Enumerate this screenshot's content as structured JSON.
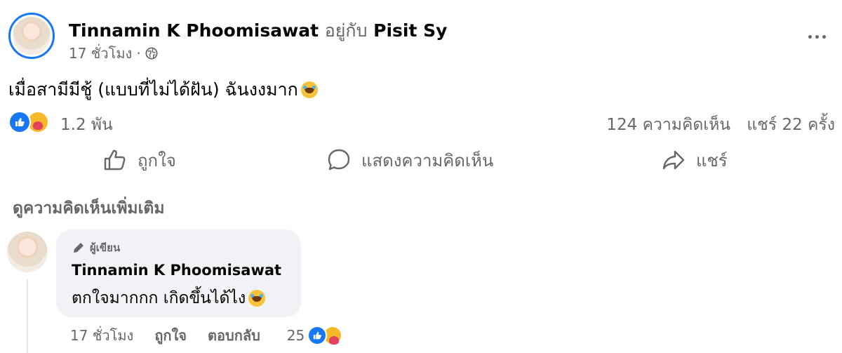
{
  "post": {
    "author": "Tinnamin K Phoomisawat",
    "with_label": "อยู่กับ",
    "tagged": "Pisit Sy",
    "time": "17 ชั่วโมง",
    "separator": "·",
    "privacy_icon": "globe-icon",
    "text": "เมื่อสามีมีชู้ (แบบที่ไม่ได้ฝัน) ฉันงงมาก",
    "emoji_icon": "rofl-emoji-icon"
  },
  "stats": {
    "reaction_count": "1.2 พัน",
    "comments": "124 ความคิดเห็น",
    "shares": "แชร์ 22 ครั้ง"
  },
  "actions": {
    "like": "ถูกใจ",
    "comment": "แสดงความคิดเห็น",
    "share": "แชร์"
  },
  "more_comments": "ดูความคิดเห็นเพิ่มเติม",
  "comment": {
    "badge": "ผู้เขียน",
    "author": "Tinnamin K Phoomisawat",
    "text": "ตกใจมากกก เกิดขึ้นได้ไง",
    "time": "17 ชั่วโมง",
    "like": "ถูกใจ",
    "reply": "ตอบกลับ",
    "reaction_count": "25"
  },
  "colors": {
    "brand": "#1877f2",
    "secondary_text": "#65676b",
    "bubble": "#f0f2f5"
  }
}
